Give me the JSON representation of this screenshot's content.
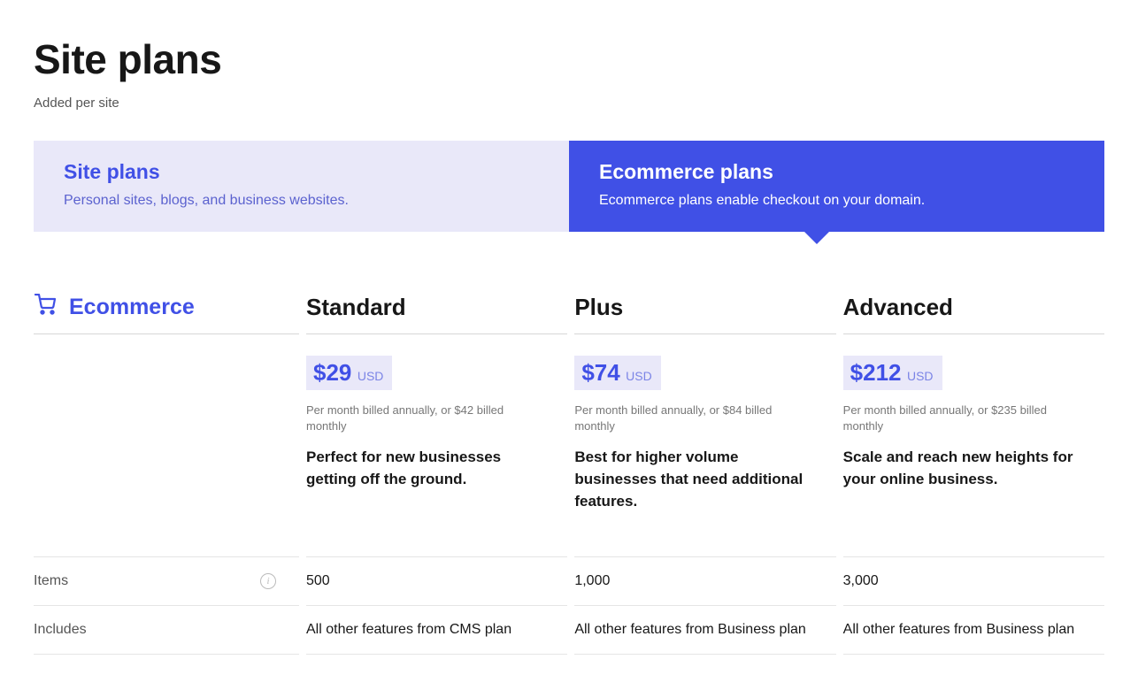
{
  "header": {
    "title": "Site plans",
    "subtitle": "Added per site"
  },
  "tabs": {
    "site": {
      "title": "Site plans",
      "desc": "Personal sites, blogs, and business websites."
    },
    "ecommerce": {
      "title": "Ecommerce plans",
      "desc": "Ecommerce plans enable checkout on your domain."
    }
  },
  "section": {
    "label": "Ecommerce"
  },
  "plans": {
    "standard": {
      "name": "Standard",
      "price": "$29",
      "currency": "USD",
      "billing": "Per month billed annually, or $42 billed monthly",
      "desc": "Perfect for new businesses getting off the ground."
    },
    "plus": {
      "name": "Plus",
      "price": "$74",
      "currency": "USD",
      "billing": "Per month billed annually, or $84 billed monthly",
      "desc": "Best for higher volume businesses that need additional features."
    },
    "advanced": {
      "name": "Advanced",
      "price": "$212",
      "currency": "USD",
      "billing": "Per month billed annually, or $235 billed monthly",
      "desc": "Scale and reach new heights for your online business."
    }
  },
  "rows": {
    "items": {
      "label": "Items",
      "standard": "500",
      "plus": "1,000",
      "advanced": "3,000"
    },
    "includes": {
      "label": "Includes",
      "standard": "All other features from CMS plan",
      "plus": "All other features from Business plan",
      "advanced": "All other features from Business plan"
    }
  }
}
